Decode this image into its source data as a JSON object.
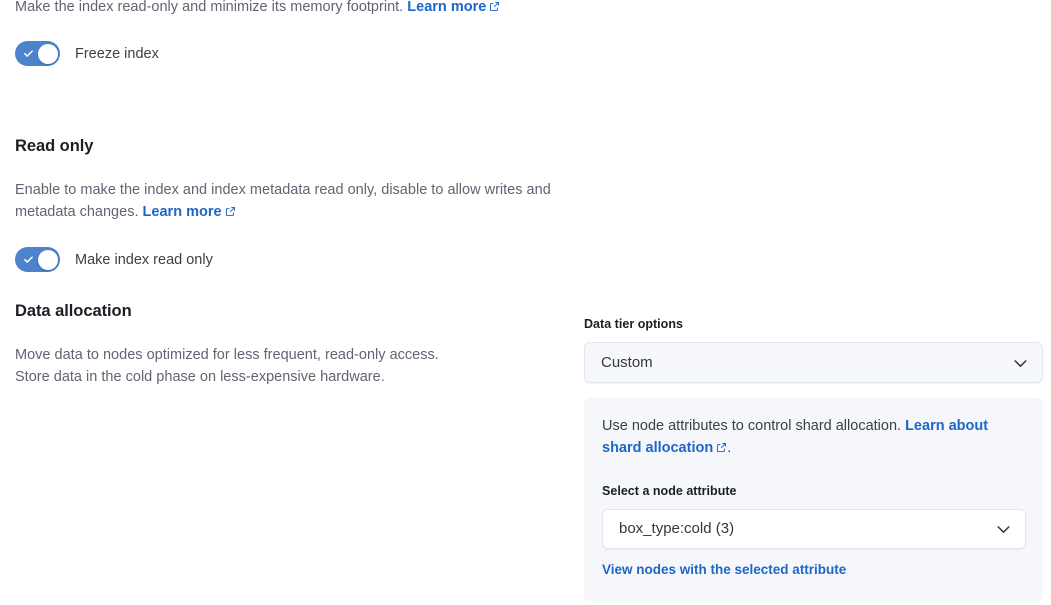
{
  "freeze_section": {
    "description_prefix": "Make the index read-only and minimize its memory footprint. ",
    "learn_more_label": "Learn more",
    "toggle_label": "Freeze index",
    "toggle_state": "on"
  },
  "read_only_section": {
    "heading": "Read only",
    "description_prefix": "Enable to make the index and index metadata read only, disable to allow writes and metadata changes. ",
    "learn_more_label": "Learn more",
    "toggle_label": "Make index read only",
    "toggle_state": "on"
  },
  "data_allocation_section": {
    "heading": "Data allocation",
    "description_line1": "Move data to nodes optimized for less frequent, read-only access.",
    "description_line2": "Store data in the cold phase on less-expensive hardware.",
    "data_tier": {
      "label": "Data tier options",
      "selected_value": "Custom"
    },
    "panel": {
      "description_prefix": "Use node attributes to control shard allocation. ",
      "link_label": "Learn about shard allocation",
      "description_suffix": ".",
      "attribute_label": "Select a node attribute",
      "attribute_value": "box_type:cold (3)",
      "view_nodes_link": "View nodes with the selected attribute"
    }
  },
  "colors": {
    "link_blue": "#1e66c7",
    "toggle_blue": "#4d82cc",
    "panel_background": "#f5f7fb",
    "select_background": "#f7f8fc",
    "heading_text": "#1b1e25",
    "body_text": "#5f6571"
  },
  "icons": {
    "external_link": "external-link-icon",
    "chevron_down": "chevron-down-icon",
    "check": "check-icon"
  }
}
